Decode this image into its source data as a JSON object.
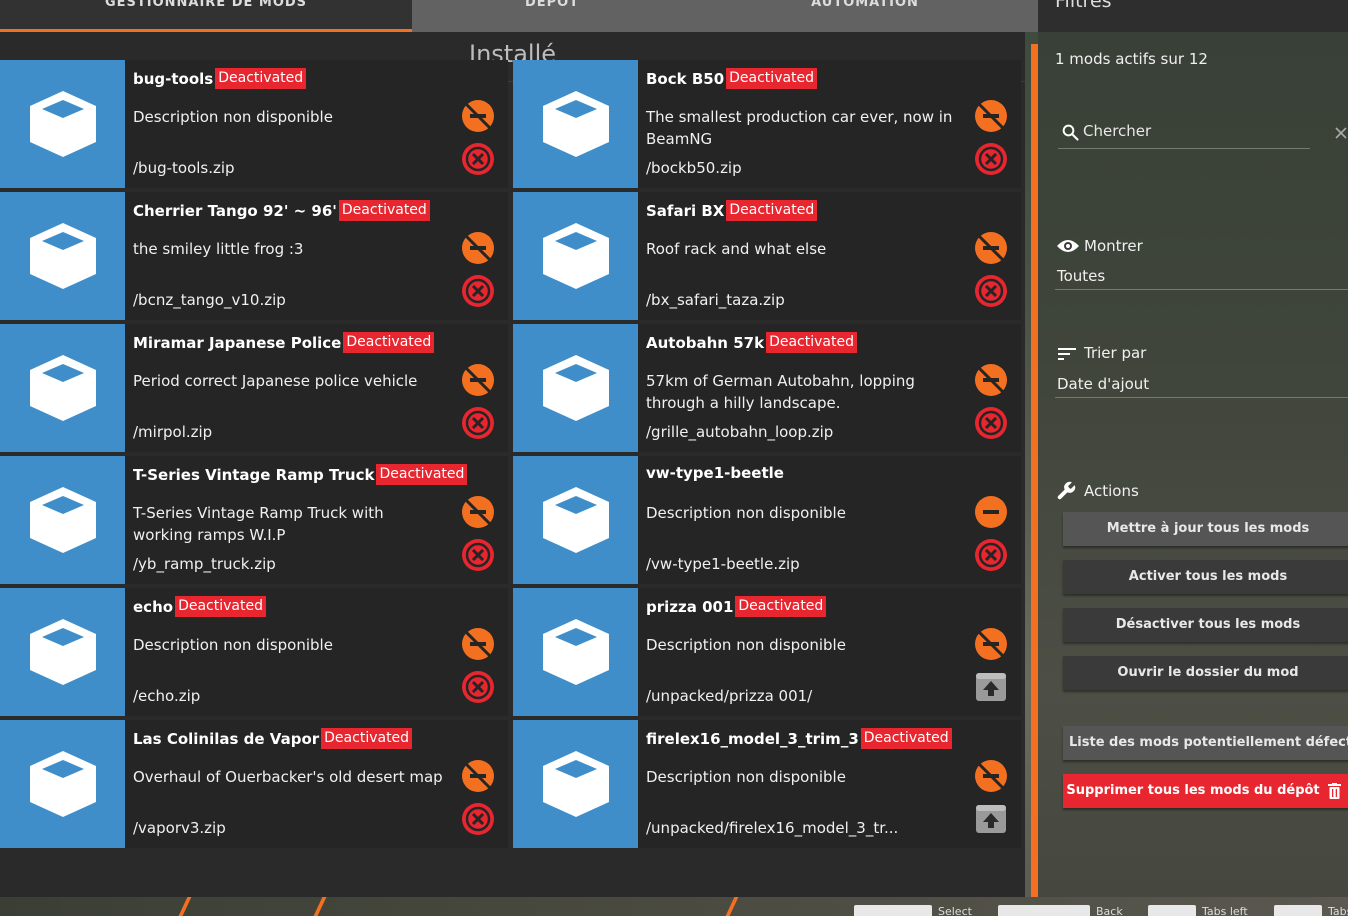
{
  "tabs": [
    {
      "label": "GESTIONNAIRE DE MODS",
      "active": true
    },
    {
      "label": "DÉPÔT",
      "active": false
    },
    {
      "label": "AUTOMATION",
      "active": false
    }
  ],
  "main": {
    "title": "Installé"
  },
  "mods": [
    {
      "name": "bug-tools",
      "badge": "Deactivated",
      "desc": "Description non disponible",
      "path": "/bug-tools.zip",
      "action": "delete"
    },
    {
      "name": "Bock B50",
      "badge": "Deactivated",
      "desc": "The smallest production car ever, now in BeamNG",
      "path": "/bockb50.zip",
      "action": "delete"
    },
    {
      "name": "Cherrier Tango 92' ~ 96'",
      "badge": "Deactivated",
      "desc": "the smiley little frog :3",
      "path": "/bcnz_tango_v10.zip",
      "action": "delete"
    },
    {
      "name": "Safari BX",
      "badge": "Deactivated",
      "desc": "Roof rack and what else",
      "path": "/bx_safari_taza.zip",
      "action": "delete"
    },
    {
      "name": "Miramar Japanese Police",
      "badge": "Deactivated",
      "desc": "Period correct Japanese police vehicle",
      "path": "/mirpol.zip",
      "action": "delete"
    },
    {
      "name": "Autobahn 57k",
      "badge": "Deactivated",
      "desc": "57km of German Autobahn, lopping through a hilly landscape.",
      "path": "/grille_autobahn_loop.zip",
      "action": "delete"
    },
    {
      "name": "T-Series Vintage Ramp Truck",
      "badge": "Deactivated",
      "desc": "T-Series Vintage Ramp Truck with working ramps W.I.P",
      "path": "/yb_ramp_truck.zip",
      "action": "delete"
    },
    {
      "name": "vw-type1-beetle",
      "badge": "",
      "desc": "Description non disponible",
      "path": "/vw-type1-beetle.zip",
      "action": "delete",
      "active": true
    },
    {
      "name": "echo",
      "badge": "Deactivated",
      "desc": "Description non disponible",
      "path": "/echo.zip",
      "action": "delete"
    },
    {
      "name": "prizza 001",
      "badge": "Deactivated",
      "desc": "Description non disponible",
      "path": "/unpacked/prizza 001/",
      "action": "pack"
    },
    {
      "name": "Las Colinilas de Vapor",
      "badge": "Deactivated",
      "desc": "Overhaul of Ouerbacker's old desert map",
      "path": "/vaporv3.zip",
      "action": "delete"
    },
    {
      "name": "firelex16_model_3_trim_3",
      "badge": "Deactivated",
      "desc": "Description non disponible",
      "path": "/unpacked/firelex16_model_3_tr...",
      "action": "pack"
    }
  ],
  "sidebar": {
    "heading": "Filtres",
    "active_count": "1 mods actifs sur 12",
    "search_placeholder": "Chercher",
    "show_label": "Montrer",
    "show_value": "Toutes",
    "sort_label": "Trier par",
    "sort_value": "Date d'ajout",
    "actions_label": "Actions",
    "buttons": [
      "Mettre à jour tous les mods",
      "Activer tous les mods",
      "Désactiver tous les mods",
      "Ouvrir le dossier du mod",
      "Liste des mods potentiellement défectueux",
      "Supprimer tous les mods du dépôt"
    ]
  },
  "colors": {
    "accent": "#f37021",
    "danger": "#e7262f",
    "thumb": "#3f8ec9",
    "panel": "#2a2a2a"
  },
  "bottom_bar": {
    "labels": [
      "Select",
      "Back",
      "Tabs left",
      "Tabs right"
    ]
  }
}
